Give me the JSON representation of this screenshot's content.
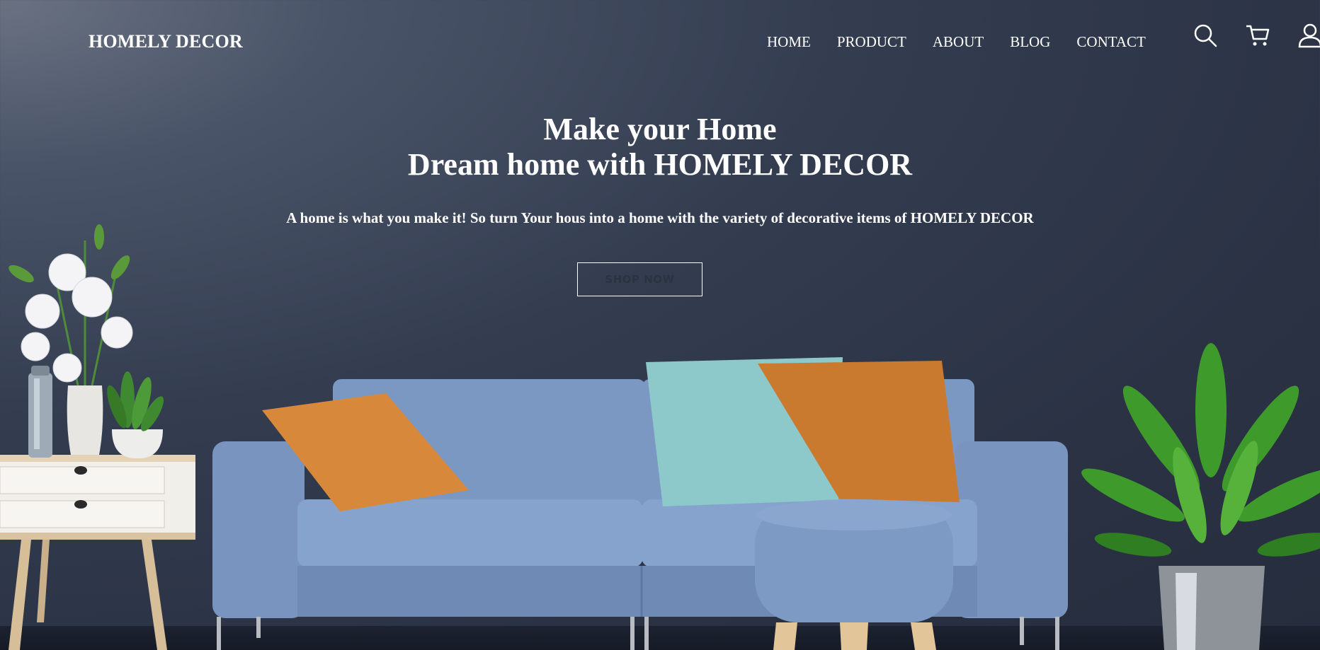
{
  "brand": "HOMELY DECOR",
  "nav": {
    "items": [
      "HOME",
      "PRODUCT",
      "ABOUT",
      "BLOG",
      "CONTACT"
    ]
  },
  "icons": [
    "search-icon",
    "cart-icon",
    "user-icon"
  ],
  "hero": {
    "title_line1": "Make your Home",
    "title_line2": "Dream home with HOMELY DECOR",
    "subtitle": "A home is what you make it! So turn Your hous into a home with the variety of decorative items of HOMELY DECOR",
    "cta_label": "SHOP NOW"
  },
  "colors": {
    "background": "#2f3748",
    "sofa": "#7f9cc6",
    "pillow_orange": "#d9893a",
    "pillow_teal": "#8ec9cc",
    "plant_green": "#3f9a2c"
  }
}
